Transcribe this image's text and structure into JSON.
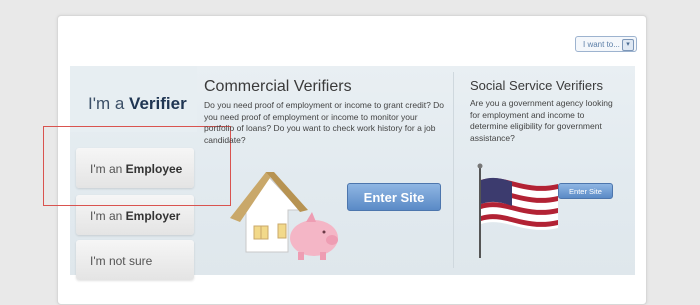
{
  "header": {
    "i_want_label": "I want to..."
  },
  "roles": {
    "verifier_prefix": "I'm a",
    "verifier_bold": "Verifier",
    "tabs": [
      {
        "prefix": "I'm an",
        "bold": "Employee"
      },
      {
        "prefix": "I'm an",
        "bold": "Employer"
      },
      {
        "prefix": "I'm not sure",
        "bold": ""
      }
    ]
  },
  "commercial": {
    "title": "Commercial Verifiers",
    "description": "Do you need proof of employment or income to grant credit? Do you need proof of employment or income to monitor your portfolio of loans? Do you want to check work history for a job candidate?",
    "button_label": "Enter Site"
  },
  "social": {
    "title": "Social Service Verifiers",
    "description": "Are you a government agency looking for employment and income to determine eligibility for government assistance?",
    "button_label": "Enter Site"
  },
  "colors": {
    "highlight": "#d9534f",
    "button": "#5a8ac6",
    "panel": "#e2eaef"
  }
}
